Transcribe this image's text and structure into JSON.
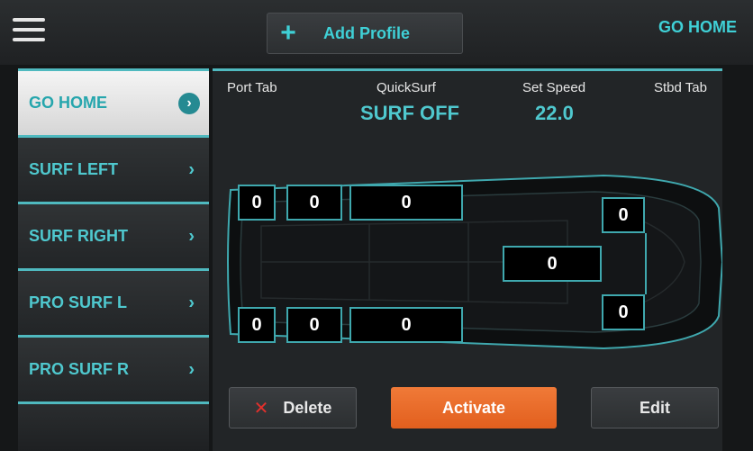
{
  "topbar": {
    "menu_icon": "hamburger-icon",
    "add_profile_icon": "plus-icon",
    "add_profile_label": "Add Profile",
    "go_home_label": "GO HOME"
  },
  "sidebar": {
    "items": [
      {
        "label": "GO HOME",
        "active": true
      },
      {
        "label": "SURF LEFT",
        "active": false
      },
      {
        "label": "SURF RIGHT",
        "active": false
      },
      {
        "label": "PRO SURF L",
        "active": false
      },
      {
        "label": "PRO SURF R",
        "active": false
      }
    ],
    "chevron": "›",
    "active_chevron": "›"
  },
  "header": {
    "port_tab": "Port Tab",
    "quicksurf": "QuickSurf",
    "quicksurf_value": "SURF OFF",
    "set_speed": "Set Speed",
    "set_speed_value": "22.0",
    "stbd_tab": "Stbd Tab"
  },
  "boat": {
    "top_left_1": "0",
    "top_left_2": "0",
    "top_left_3": "0",
    "center": "0",
    "right_top": "0",
    "right_bottom": "0",
    "bottom_left_1": "0",
    "bottom_left_2": "0",
    "bottom_left_3": "0"
  },
  "actions": {
    "delete_icon": "x-icon",
    "delete_label": "Delete",
    "activate_label": "Activate",
    "edit_label": "Edit"
  },
  "colors": {
    "accent": "#3fd0d6",
    "activate": "#e8692a",
    "delete_x": "#e2302c"
  }
}
